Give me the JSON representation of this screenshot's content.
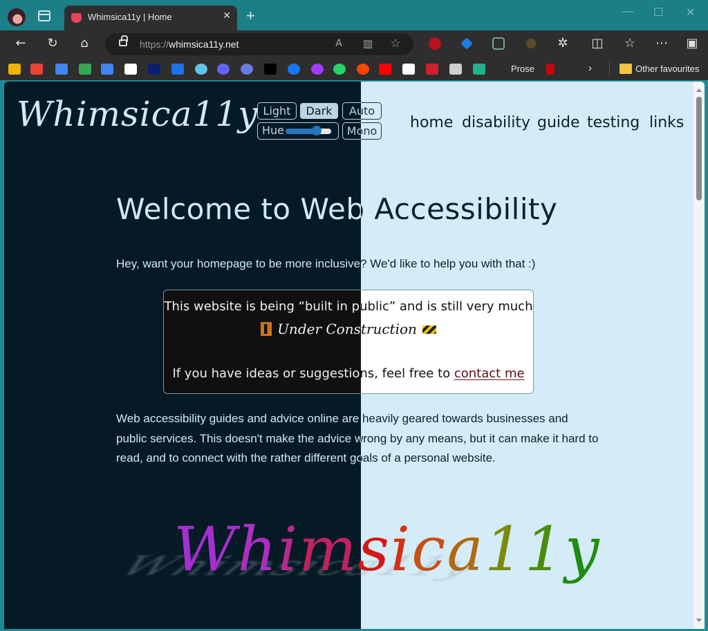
{
  "browser": {
    "tab_title": "Whimsica11y | Home",
    "new_tab_icon": "plus-icon",
    "address": {
      "scheme": "https://",
      "host": "whimsica11y.net"
    },
    "window_controls": [
      "minimize",
      "maximize",
      "close"
    ],
    "toolbar_icons": [
      "back-icon",
      "refresh-icon",
      "home-icon",
      "read-aloud-icon",
      "immersive-reader-icon",
      "favorite-star-icon",
      "ublock-icon",
      "diamond-extension-icon",
      "s-extension-icon",
      "c-extension-icon",
      "extensions-puzzle-icon",
      "split-screen-icon",
      "favorites-icon",
      "more-icon",
      "sidebar-icon"
    ],
    "bookmarks": [
      {
        "name": "bookmark-a",
        "color": "#f0b400"
      },
      {
        "name": "gmail",
        "color": "#ea4335"
      },
      {
        "name": "calendar",
        "color": "#4285f4"
      },
      {
        "name": "maps",
        "color": "#34a853"
      },
      {
        "name": "translate",
        "color": "#4285f4"
      },
      {
        "name": "dots",
        "color": "#ffffff"
      },
      {
        "name": "ndr",
        "color": "#0a1f6e"
      },
      {
        "name": "bookmark-blue",
        "color": "#1a73e8"
      },
      {
        "name": "globe",
        "color": "#62c6e8"
      },
      {
        "name": "mastodon",
        "color": "#6364ff"
      },
      {
        "name": "chrome-red",
        "color": "#6a7bdc"
      },
      {
        "name": "x",
        "color": "#000000"
      },
      {
        "name": "facebook",
        "color": "#1877f2"
      },
      {
        "name": "messenger",
        "color": "#a33bff"
      },
      {
        "name": "whatsapp",
        "color": "#25d366"
      },
      {
        "name": "reddit",
        "color": "#ff4500"
      },
      {
        "name": "youtube",
        "color": "#ff0000"
      },
      {
        "name": "amazon",
        "color": "#ffffff"
      },
      {
        "name": "bookmark-red",
        "color": "#d0202c"
      },
      {
        "name": "window",
        "color": "#cfcfcf"
      },
      {
        "name": "green-arrow",
        "color": "#1fb28c"
      }
    ],
    "bookmark_text_item": "Prose",
    "bookmark_overflow_icon": "chevron-right-icon",
    "other_favourites": "Other favourites"
  },
  "site": {
    "logo": "Whimsica11y",
    "theme": {
      "light": "Light",
      "dark": "Dark",
      "auto": "Auto",
      "hue": "Hue",
      "mono": "Mono",
      "active": "Dark",
      "hue_value_fraction": 0.62
    },
    "nav": [
      "home",
      "disability",
      "guide",
      "testing",
      "links"
    ],
    "heading": "Welcome to Web Accessibility",
    "intro": "Hey, want your homepage to be more inclusive? We'd like to help you with that :)",
    "notice": {
      "line1": "This website is being “built in public” and is still very much",
      "under_construction": "Under Construction",
      "line3_prefix": "If you have ideas or suggestions, feel free to ",
      "contact_link": "contact me"
    },
    "body": "Web accessibility guides and advice online are heavily geared towards businesses and public services. This doesn't make the advice wrong by any means, but it can make it hard to read, and to connect with the rather different goals of a personal website.",
    "big_logo_letters": [
      {
        "ch": "W",
        "color": "#a52fd0"
      },
      {
        "ch": "h",
        "color": "#ad2ec0"
      },
      {
        "ch": "i",
        "color": "#b8298f"
      },
      {
        "ch": "m",
        "color": "#c0225e"
      },
      {
        "ch": "s",
        "color": "#d41818"
      },
      {
        "ch": "i",
        "color": "#d43014"
      },
      {
        "ch": "c",
        "color": "#c85018"
      },
      {
        "ch": "a",
        "color": "#b06a10"
      },
      {
        "ch": "1",
        "color": "#7c8a0a"
      },
      {
        "ch": "1",
        "color": "#4a8e08"
      },
      {
        "ch": "y",
        "color": "#208c10"
      }
    ],
    "colors": {
      "dark_bg": "#061a26",
      "light_bg": "#d4ecf7",
      "dark_fg": "#cfeaf4",
      "light_fg": "#0a2230",
      "link_underline": "#7a0d1a"
    }
  }
}
